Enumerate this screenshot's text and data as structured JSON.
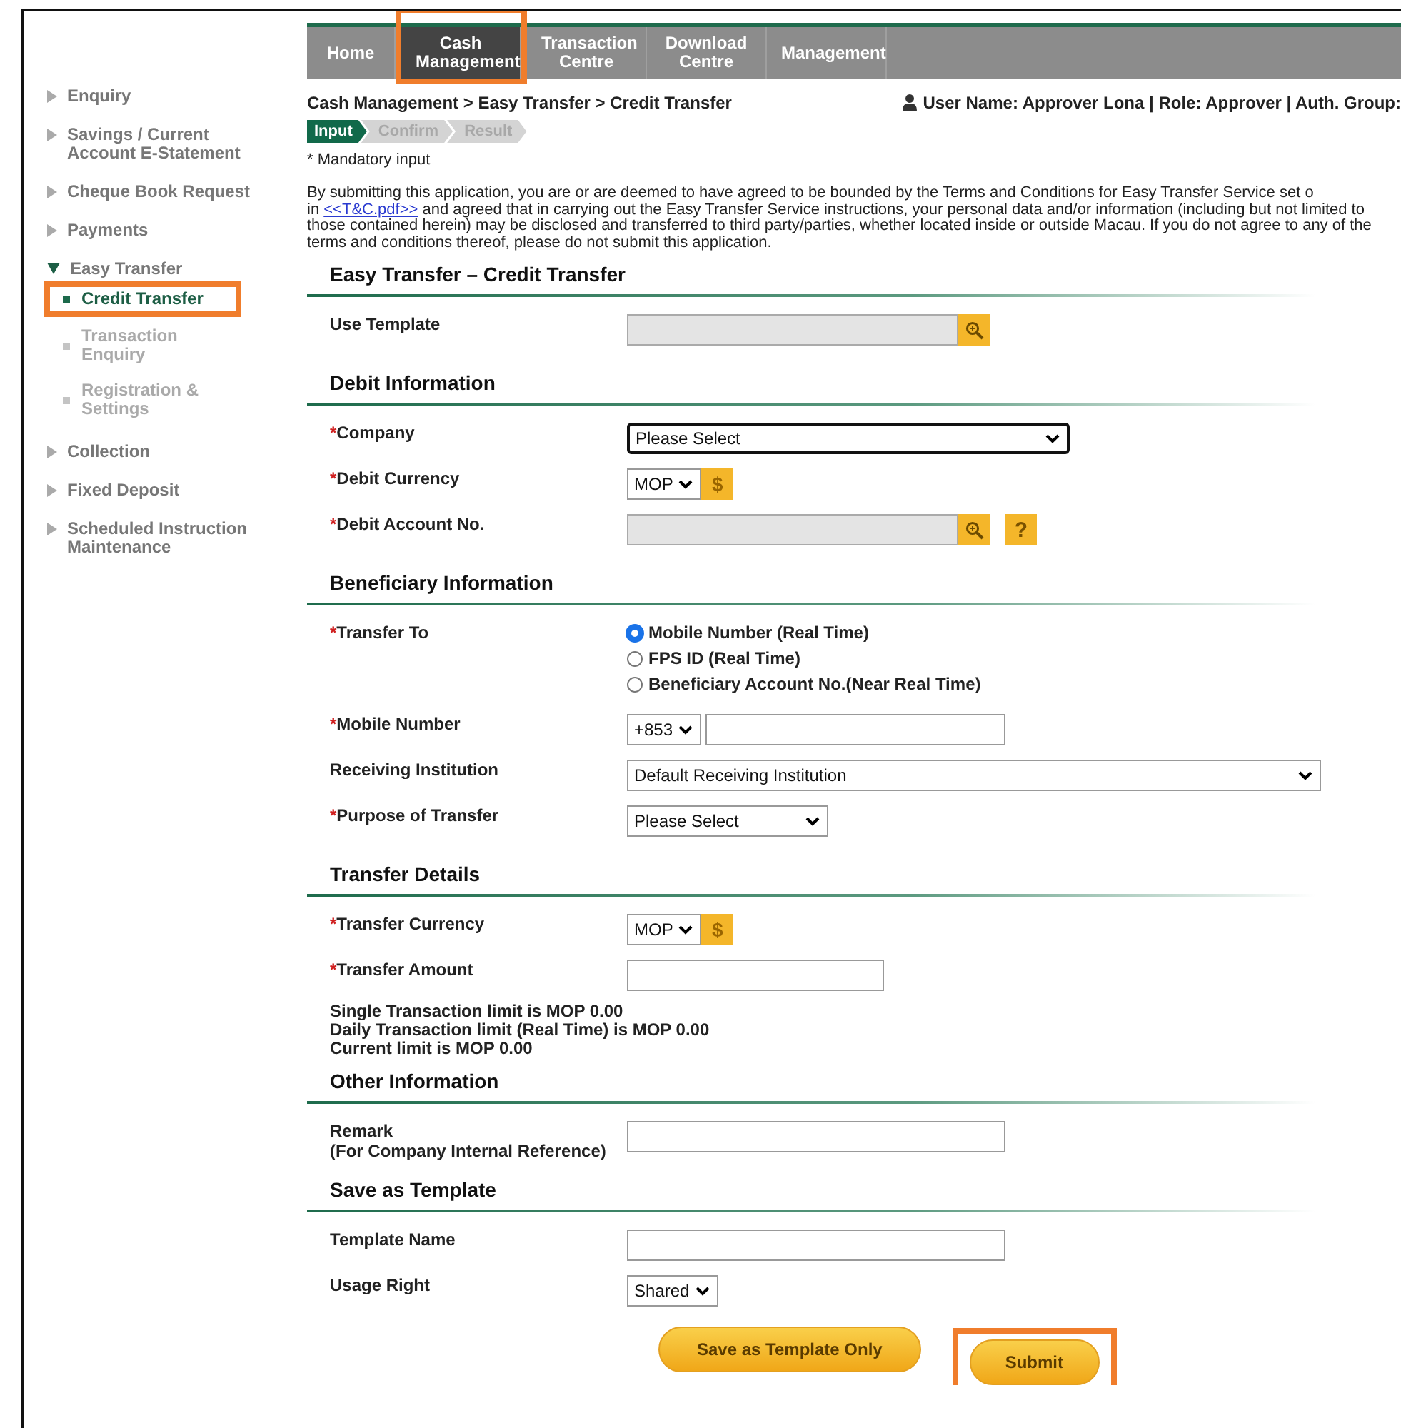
{
  "nav": [
    {
      "label": "Home",
      "selected": false,
      "highlighted": false
    },
    {
      "label": "Cash Management",
      "selected": true,
      "highlighted": true
    },
    {
      "label": "Transaction Centre",
      "selected": false,
      "highlighted": false
    },
    {
      "label": "Download Centre",
      "selected": false,
      "highlighted": false
    },
    {
      "label": "Management",
      "selected": false,
      "highlighted": false
    }
  ],
  "sidebar": {
    "items": [
      {
        "label": "Enquiry",
        "expanded": false
      },
      {
        "label": "Savings / Current Account E-Statement",
        "expanded": false
      },
      {
        "label": "Cheque Book Request",
        "expanded": false
      },
      {
        "label": "Payments",
        "expanded": false
      },
      {
        "label": "Easy Transfer",
        "expanded": true,
        "children": [
          {
            "label": "Credit Transfer",
            "selected": true,
            "highlighted": true
          },
          {
            "label": "Transaction Enquiry",
            "selected": false,
            "highlighted": false
          },
          {
            "label": "Registration & Settings",
            "selected": false,
            "highlighted": false
          }
        ]
      },
      {
        "label": "Collection",
        "expanded": false
      },
      {
        "label": "Fixed Deposit",
        "expanded": false
      },
      {
        "label": "Scheduled Instruction Maintenance",
        "expanded": false
      }
    ]
  },
  "breadcrumb": "Cash Management > Easy Transfer > Credit Transfer",
  "user_info": "User Name: Approver Lona | Role: Approver | Auth. Group:",
  "steps": [
    {
      "label": "Input",
      "selected": true
    },
    {
      "label": "Confirm",
      "selected": false
    },
    {
      "label": "Result",
      "selected": false
    }
  ],
  "mandatory_note": "* Mandatory input",
  "notice": {
    "lead": "By submitting this application, you are or are deemed to have agreed to be bounded by the Terms and Conditions for Easy Transfer Service set o",
    "prefix": "in",
    "link": "<<T&C.pdf>>",
    "rest": "and agreed that in carrying out the Easy Transfer Service instructions, your personal data and/or information (including but not limited to those contained herein) may be disclosed and transferred to third party/parties, whether located inside or outside Macau. If you do not agree to any of the terms and conditions thereof, please do not submit this application."
  },
  "sections": [
    {
      "title": "Easy Transfer – Credit Transfer",
      "rows": [
        {
          "kind": "lookup",
          "label": "Use Template"
        }
      ]
    },
    {
      "title": "Debit Information",
      "rows": [
        {
          "kind": "wide_select",
          "marker": "*",
          "label": "Company",
          "value": "Please Select",
          "focused": true
        },
        {
          "kind": "currency",
          "marker": "*",
          "label": "Debit Currency",
          "value": "MOP",
          "button": "$"
        },
        {
          "kind": "lookup",
          "marker": "*",
          "label": "Debit Account No.",
          "help": "?"
        }
      ]
    },
    {
      "title": "Beneficiary Information",
      "rows": [
        {
          "kind": "radio",
          "marker": "*",
          "label": "Transfer To",
          "options": [
            {
              "label": "Mobile Number (Real Time)",
              "selected": true
            },
            {
              "label": "FPS ID (Real Time)",
              "selected": false
            },
            {
              "label": "Beneficiary Account No.(Near Real Time)",
              "selected": false
            }
          ]
        },
        {
          "kind": "phone",
          "marker": "*",
          "label": "Mobile Number",
          "value": "+853"
        },
        {
          "kind": "long_select",
          "label": "Receiving Institution",
          "value": "Default Receiving Institution"
        },
        {
          "kind": "select",
          "marker": "*",
          "label": "Purpose of Transfer",
          "value": "Please Select"
        }
      ]
    },
    {
      "title": "Transfer Details",
      "rows": [
        {
          "kind": "currency",
          "marker": "*",
          "label": "Transfer Currency",
          "value": "MOP",
          "button": "$"
        },
        {
          "kind": "text",
          "marker": "*",
          "label": "Transfer Amount"
        },
        {
          "kind": "note",
          "lines": [
            "Single Transaction limit is MOP 0.00",
            "Daily Transaction limit (Real Time) is MOP 0.00",
            "Current limit is MOP 0.00"
          ]
        }
      ]
    },
    {
      "title": "Other Information",
      "rows": [
        {
          "kind": "text",
          "label": "Remark",
          "sublabel": "(For Company Internal Reference)"
        }
      ]
    },
    {
      "title": "Save as Template",
      "rows": [
        {
          "kind": "text",
          "label": "Template Name"
        },
        {
          "kind": "small_select",
          "label": "Usage Right",
          "value": "Shared"
        }
      ]
    }
  ],
  "buttons": [
    {
      "label": "Save as Template Only",
      "highlighted": false
    },
    {
      "label": "Submit",
      "highlighted": true
    }
  ]
}
